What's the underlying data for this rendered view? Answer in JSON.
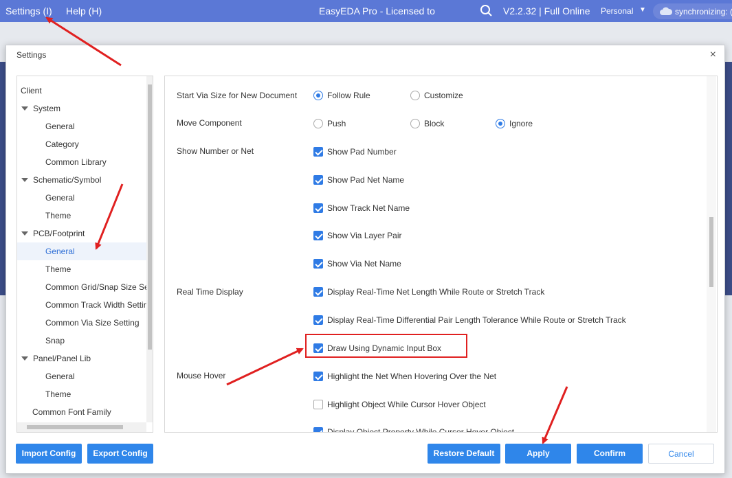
{
  "topbar": {
    "menu_settings": "Settings (I)",
    "menu_help": "Help (H)",
    "app_title": "EasyEDA Pro - Licensed to",
    "version": "V2.2.32 | Full Online",
    "workspace": "Personal",
    "sync_status": "synchronizing: (",
    "colors": {
      "bar": "#5b78d6"
    }
  },
  "dialog": {
    "title": "Settings",
    "close_symbol": "×"
  },
  "tree": {
    "items": [
      {
        "label": "Client"
      },
      {
        "label": "System"
      },
      {
        "label": "General"
      },
      {
        "label": "Category"
      },
      {
        "label": "Common Library"
      },
      {
        "label": "Schematic/Symbol"
      },
      {
        "label": "General"
      },
      {
        "label": "Theme"
      },
      {
        "label": "PCB/Footprint"
      },
      {
        "label": "General",
        "selected": true
      },
      {
        "label": "Theme"
      },
      {
        "label": "Common Grid/Snap Size Se"
      },
      {
        "label": "Common Track Width Settir"
      },
      {
        "label": "Common Via Size Setting"
      },
      {
        "label": "Snap"
      },
      {
        "label": "Panel/Panel Lib"
      },
      {
        "label": "General"
      },
      {
        "label": "Theme"
      },
      {
        "label": "Common Font Family"
      }
    ]
  },
  "settings": {
    "via_size": {
      "label": "Start Via Size for New Document",
      "options": [
        "Follow Rule",
        "Customize"
      ],
      "selected": "Follow Rule"
    },
    "move_component": {
      "label": "Move Component",
      "options": [
        "Push",
        "Block",
        "Ignore"
      ],
      "selected": "Ignore"
    },
    "show_number_or_net": {
      "label": "Show Number or Net",
      "options": [
        {
          "label": "Show Pad Number",
          "checked": true
        },
        {
          "label": "Show Pad Net Name",
          "checked": true
        },
        {
          "label": "Show Track Net Name",
          "checked": true
        },
        {
          "label": "Show Via Layer Pair",
          "checked": true
        },
        {
          "label": "Show Via Net Name",
          "checked": true
        }
      ]
    },
    "real_time_display": {
      "label": "Real Time Display",
      "options": [
        {
          "label": "Display Real-Time Net Length While Route or Stretch Track",
          "checked": true
        },
        {
          "label": "Display Real-Time Differential Pair Length Tolerance While Route or Stretch Track",
          "checked": true
        },
        {
          "label": "Draw Using Dynamic Input Box",
          "checked": true
        }
      ]
    },
    "mouse_hover": {
      "label": "Mouse Hover",
      "options": [
        {
          "label": "Highlight the Net When Hovering Over the Net",
          "checked": true
        },
        {
          "label": "Highlight Object While Cursor Hover Object",
          "checked": false
        },
        {
          "label": "Display Object Property While Cursor Hover Object",
          "checked": true
        }
      ]
    }
  },
  "buttons": {
    "import_config": "Import Config",
    "export_config": "Export Config",
    "restore_default": "Restore Default",
    "apply": "Apply",
    "confirm": "Confirm",
    "cancel": "Cancel"
  },
  "accent": {
    "primary": "#2f86ea",
    "annotation": "#e02020"
  }
}
